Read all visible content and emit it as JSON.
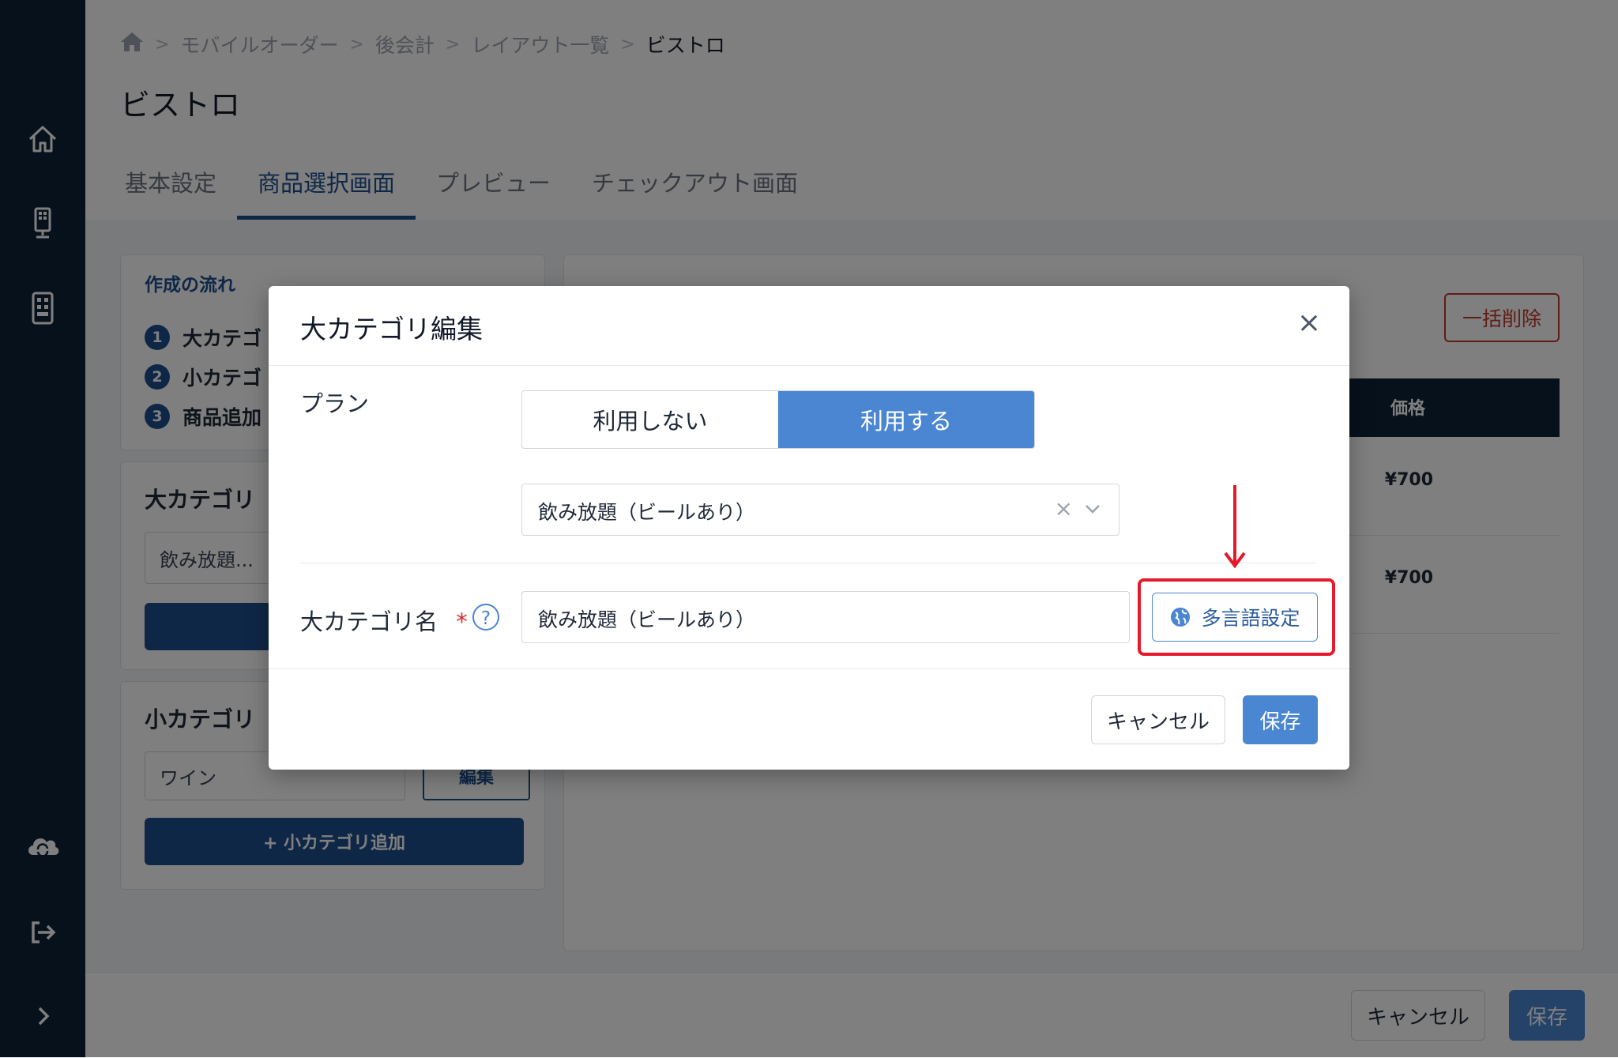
{
  "colors": {
    "sidebar_bg": "#0f2337",
    "primary": "#4a86d1",
    "primary_dark": "#1e4f8f",
    "highlight_red": "#e5192b",
    "danger": "#c0392b"
  },
  "sidebar": {
    "icons": [
      "home-icon",
      "kiosk-icon",
      "tablet-icon",
      "cloud-sync-icon",
      "logout-icon",
      "chevron-right-icon"
    ]
  },
  "breadcrumb": {
    "items": [
      "モバイルオーダー",
      "後会計",
      "レイアウト一覧"
    ],
    "current": "ビストロ"
  },
  "page": {
    "title": "ビストロ"
  },
  "tabs": [
    {
      "label": "基本設定"
    },
    {
      "label": "商品選択画面"
    },
    {
      "label": "プレビュー"
    },
    {
      "label": "チェックアウト画面"
    }
  ],
  "flow": {
    "title": "作成の流れ",
    "steps": [
      {
        "num": "1",
        "label": "大カテゴ"
      },
      {
        "num": "2",
        "label": "小カテゴ"
      },
      {
        "num": "3",
        "label": "商品追加"
      }
    ]
  },
  "major_category_card": {
    "title": "大カテゴリ",
    "value": "飲み放題..."
  },
  "minor_category_card": {
    "title": "小カテゴリ",
    "value": "ワイン",
    "edit_label": "編集",
    "add_label": "+ 小カテゴリ追加"
  },
  "product_panel": {
    "bulk_delete_label": "一括削除",
    "price_header": "価格",
    "rows": [
      {
        "price": "¥700"
      },
      {
        "price": "¥700"
      }
    ]
  },
  "bottom_bar": {
    "cancel_label": "キャンセル",
    "save_label": "保存"
  },
  "modal": {
    "title": "大カテゴリ編集",
    "close_symbol": "×",
    "plan_label": "プラン",
    "plan_options": [
      "利用しない",
      "利用する"
    ],
    "plan_selected": "利用する",
    "plan_select_value": "飲み放題（ビールあり）",
    "clear_symbol": "×",
    "name_label": "大カテゴリ名",
    "required_mark": "*",
    "help_symbol": "?",
    "name_value": "飲み放題（ビールあり）",
    "multilang_label": "多言語設定",
    "cancel_label": "キャンセル",
    "save_label": "保存"
  }
}
